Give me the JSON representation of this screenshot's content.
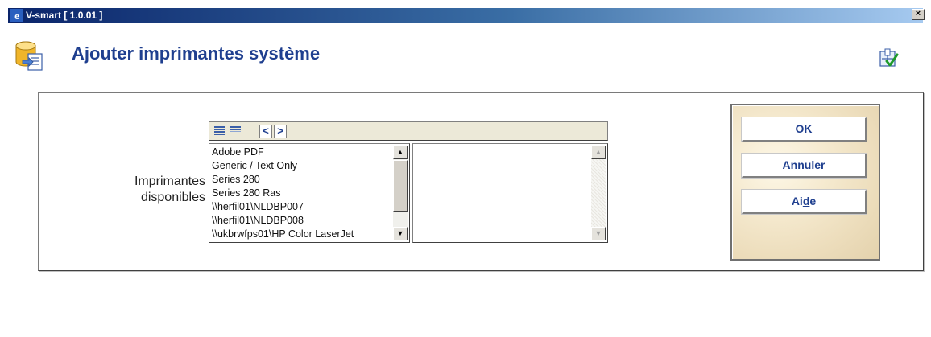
{
  "window": {
    "title": "V-smart [ 1.0.01 ]",
    "close_label": "×",
    "app_icon": "internet-explorer-icon"
  },
  "header": {
    "title": "Ajouter imprimantes système",
    "icon": "database-form-icon",
    "right_icon": "select-check-icon"
  },
  "form": {
    "field_label_line1": "Imprimantes",
    "field_label_line2": "disponibles",
    "toolbar": {
      "select_all_icon": "select-all-icon",
      "deselect_all_icon": "deselect-all-icon",
      "move_left_label": "<",
      "move_right_label": ">"
    },
    "available_printers": [
      "Adobe PDF",
      "Generic / Text Only",
      "Series 280",
      "Series 280 Ras",
      "\\\\herfil01\\NLDBP007",
      "\\\\herfil01\\NLDBP008",
      "\\\\ukbrwfps01\\HP Color LaserJet"
    ],
    "selected_printers": [],
    "scroll_up": "▲",
    "scroll_down": "▼"
  },
  "buttons": {
    "ok": "OK",
    "cancel": "Annuler",
    "help_pre": "Ai",
    "help_underlined": "d",
    "help_post": "e"
  },
  "colors": {
    "title_text": "#1f3f8f",
    "titlebar_dark": "#0a246a",
    "titlebar_light": "#a6caf0"
  }
}
